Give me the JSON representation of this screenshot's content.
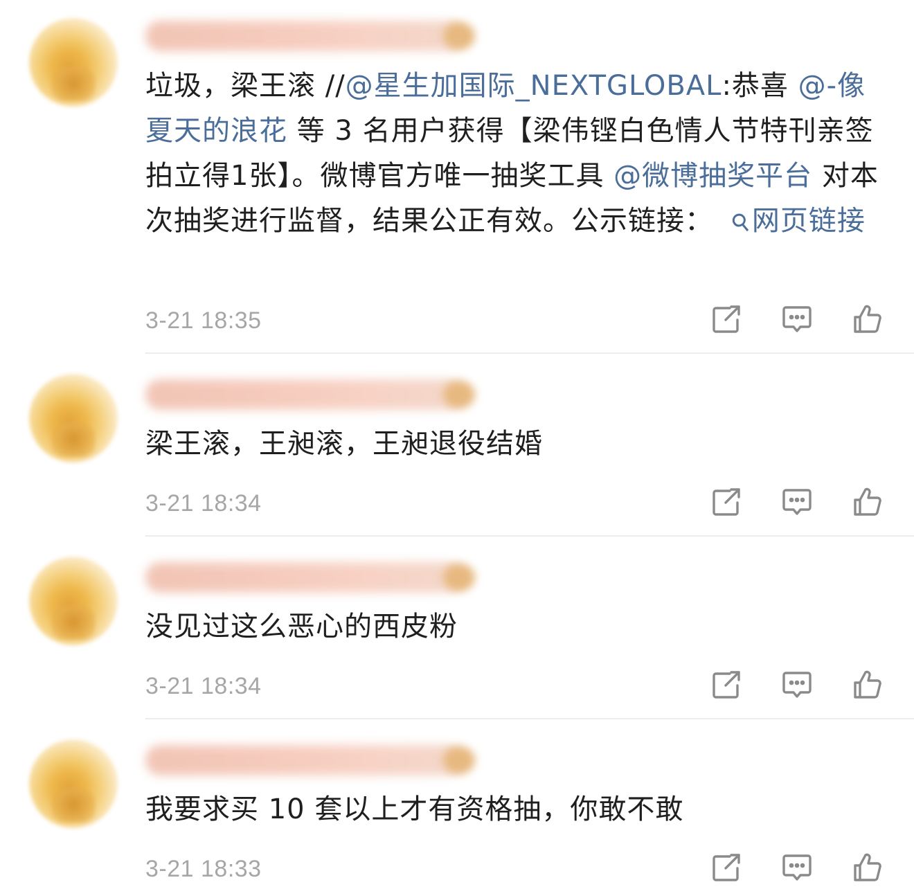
{
  "comments": [
    {
      "segments": [
        {
          "text": "垃圾，梁王滚 //",
          "type": "text"
        },
        {
          "text": "@星生加国际_NEXTGLOBAL",
          "type": "mention"
        },
        {
          "text": ":恭喜 ",
          "type": "text"
        },
        {
          "text": "@-像夏天的浪花",
          "type": "mention"
        },
        {
          "text": " 等 3 名用户获得【梁伟铿白色情人节特刊亲签拍立得1张】。微博官方唯一抽奖工具 ",
          "type": "text"
        },
        {
          "text": "@微博抽奖平台",
          "type": "mention"
        },
        {
          "text": " 对本次抽奖进行监督，结果公正有效。公示链接：",
          "type": "text"
        },
        {
          "text": "网页链接",
          "type": "weblink"
        }
      ],
      "timestamp": "3-21 18:35"
    },
    {
      "segments": [
        {
          "text": "梁王滚，王昶滚，王昶退役结婚",
          "type": "text"
        }
      ],
      "timestamp": "3-21 18:34"
    },
    {
      "segments": [
        {
          "text": "没见过这么恶心的西皮粉",
          "type": "text"
        }
      ],
      "timestamp": "3-21 18:34"
    },
    {
      "segments": [
        {
          "text": "我要求买 10 套以上才有资格抽，你敢不敢",
          "type": "text"
        }
      ],
      "timestamp": "3-21 18:33"
    }
  ],
  "icons": {
    "share": "share-icon",
    "comment": "comment-icon",
    "like": "thumbs-up-icon",
    "weblink": "link-icon"
  },
  "colors": {
    "link": "#4a6e99",
    "timestamp": "#a6a6a6",
    "text": "#1f1f1f",
    "icon": "#8a8a8a"
  }
}
